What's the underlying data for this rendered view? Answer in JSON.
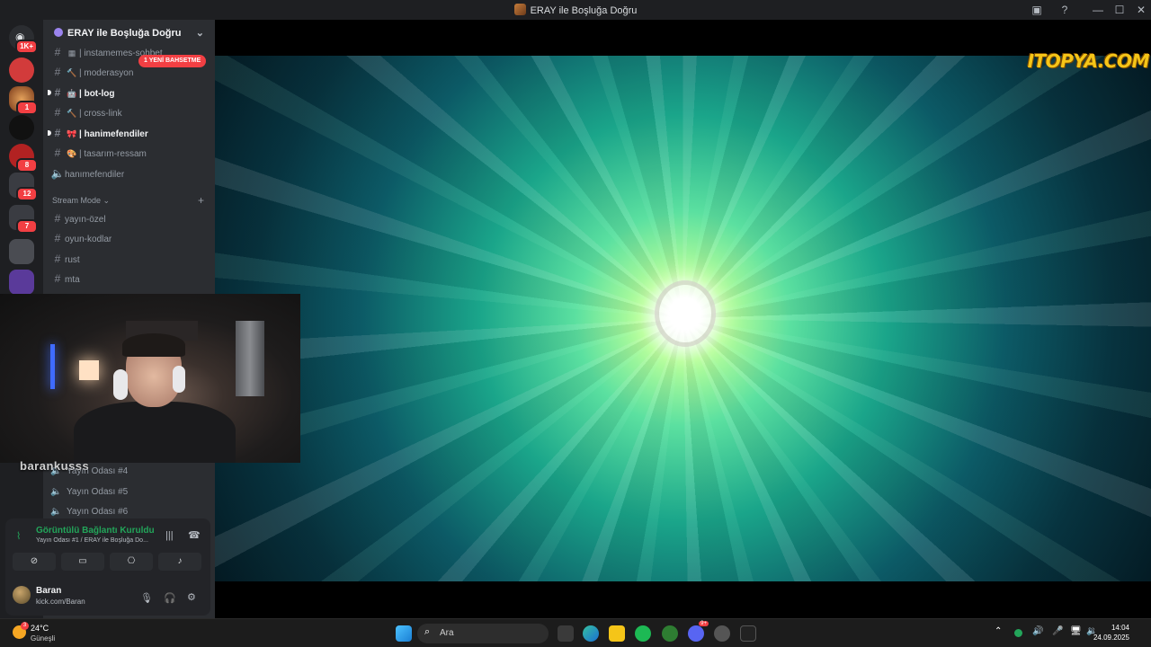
{
  "window": {
    "title": "ERAY ile Boşluğa Doğru"
  },
  "server": {
    "name": "ERAY ile Boşluğa Doğru"
  },
  "guild_badges": [
    "1K+",
    "1",
    "8",
    "12",
    "7"
  ],
  "mention_pill": "1 YENİ BAHSETME",
  "channels": [
    {
      "name": "instamemes-sohbet",
      "emoji": "▦",
      "sep": "|",
      "bold": false,
      "unread": false,
      "type": "text"
    },
    {
      "name": "moderasyon",
      "emoji": "🔨",
      "sep": "|",
      "bold": false,
      "unread": false,
      "type": "text"
    },
    {
      "name": "bot-log",
      "emoji": "🤖",
      "sep": "|",
      "bold": true,
      "unread": true,
      "type": "text"
    },
    {
      "name": "cross-link",
      "emoji": "🔨",
      "sep": "|",
      "bold": false,
      "unread": false,
      "type": "text"
    },
    {
      "name": "hanimefendiler",
      "emoji": "🎀",
      "sep": "|",
      "bold": true,
      "unread": true,
      "type": "text"
    },
    {
      "name": "tasarım-ressam",
      "emoji": "🎨",
      "sep": "|",
      "bold": false,
      "unread": false,
      "type": "text"
    },
    {
      "name": "hanımefendiler",
      "emoji": "",
      "sep": "",
      "bold": false,
      "unread": false,
      "type": "voice"
    }
  ],
  "category": {
    "name": "Stream Mode",
    "chevron": "⌄",
    "add": "+"
  },
  "stream_channels": [
    "yayın-özel",
    "oyun-kodlar",
    "rust",
    "mta"
  ],
  "webcam_overlay_name": "barankusss",
  "voice_channels": [
    "Yayın Odası #4",
    "Yayın Odası #5",
    "Yayın Odası #6"
  ],
  "voice_panel": {
    "status": "Görüntülü Bağlantı Kuruldu",
    "sub": "Yayın Odası #1 / ERAY ile Boşluğa Do...",
    "buttons": [
      "camera-off-icon",
      "screen-share-icon",
      "activities-icon",
      "soundboard-icon"
    ]
  },
  "user": {
    "name": "Baran",
    "status": "kick.com/Baran"
  },
  "stream": {
    "watermark": "ITOPYA.COM"
  },
  "taskbar": {
    "weather_temp": "24°C",
    "weather_cond": "Güneşli",
    "weather_badge": "3",
    "search_placeholder": "Ara",
    "discord_badge": "9+",
    "clock_time": "14:04",
    "clock_date": "24.09.2025"
  },
  "colors": {
    "online": "#23a55a",
    "danger": "#f23f43",
    "watermark": "#f5c518"
  }
}
